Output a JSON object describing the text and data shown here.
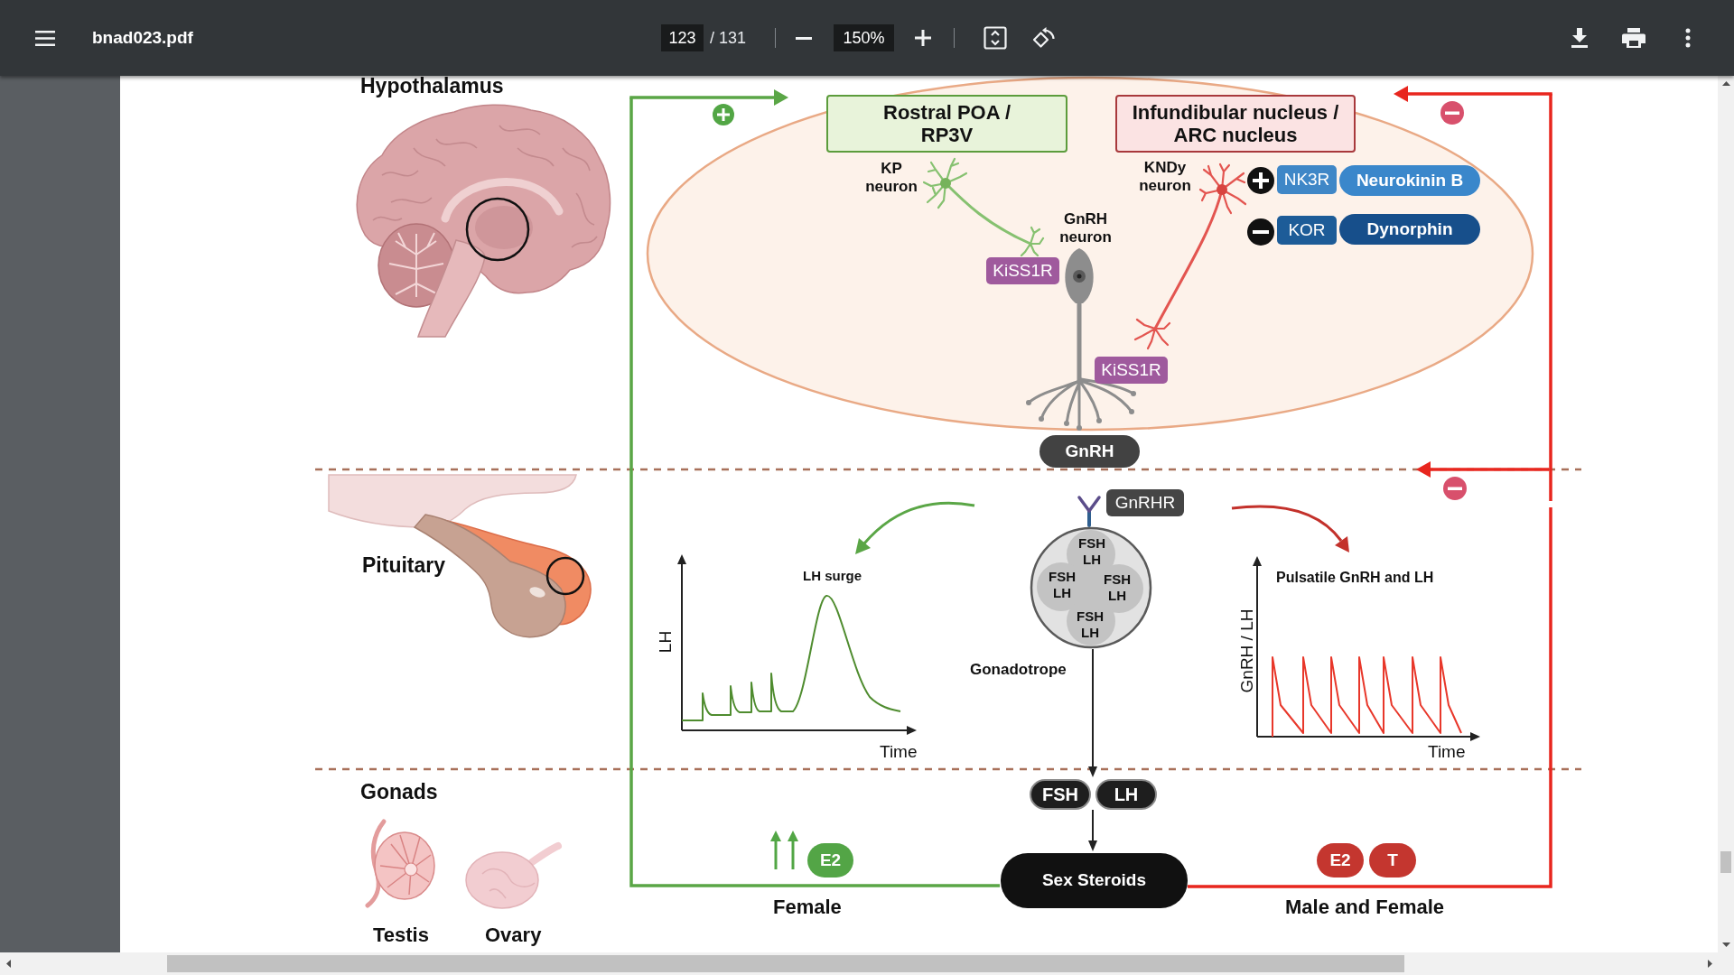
{
  "viewer": {
    "file_name": "bnad023.pdf",
    "page": "123",
    "page_total": "/ 131",
    "zoom": "150%"
  },
  "hypothalamus": {
    "heading": "Hypothalamus",
    "nuclei": [
      {
        "kind": "rostral",
        "lines": [
          "Rostral POA /",
          "RP3V"
        ]
      },
      {
        "kind": "arcuate",
        "lines": [
          "Infundibular nucleus /",
          "ARC nucleus"
        ]
      }
    ],
    "neurons": [
      {
        "kind": "kp",
        "label": "KP neuron"
      },
      {
        "kind": "gnrh",
        "label": "GnRH neuron"
      },
      {
        "kind": "kndy",
        "label": "KNDy neuron"
      }
    ],
    "kiss1_receptors": [
      "KiSS1R",
      "KiSS1R"
    ],
    "inputs": [
      {
        "kind": "stimulatory",
        "receptor": "NK3R",
        "ligand": "Neurokinin B"
      },
      {
        "kind": "inhibitory",
        "receptor": "KOR",
        "ligand": "Dynorphin"
      }
    ],
    "output": "GnRH"
  },
  "pituitary": {
    "heading": "Pituitary",
    "receptor": "GnRHR",
    "granules": [
      [
        "FSH",
        "LH"
      ],
      [
        "FSH",
        "LH"
      ],
      [
        "FSH",
        "LH"
      ],
      [
        "FSH",
        "LH"
      ]
    ],
    "cell_label": "Gonadotrope",
    "charts": [
      {
        "kind": "surge",
        "title": "LH surge",
        "ylabel": "LH",
        "xlabel": "Time"
      },
      {
        "kind": "pulsatile",
        "title": "Pulsatile GnRH and LH",
        "ylabel": "GnRH / LH",
        "xlabel": "Time"
      }
    ],
    "outputs": [
      "FSH",
      "LH"
    ]
  },
  "gonads": {
    "heading": "Gonads",
    "organs": [
      {
        "kind": "testis",
        "label": "Testis"
      },
      {
        "kind": "ovary",
        "label": "Ovary"
      }
    ],
    "product": "Sex Steroids"
  },
  "feedback": [
    {
      "kind": "positive",
      "steroids": [
        "E2"
      ],
      "label": "Female"
    },
    {
      "kind": "negative",
      "steroids": [
        "E2",
        "T"
      ],
      "label": "Male and Female"
    }
  ]
}
